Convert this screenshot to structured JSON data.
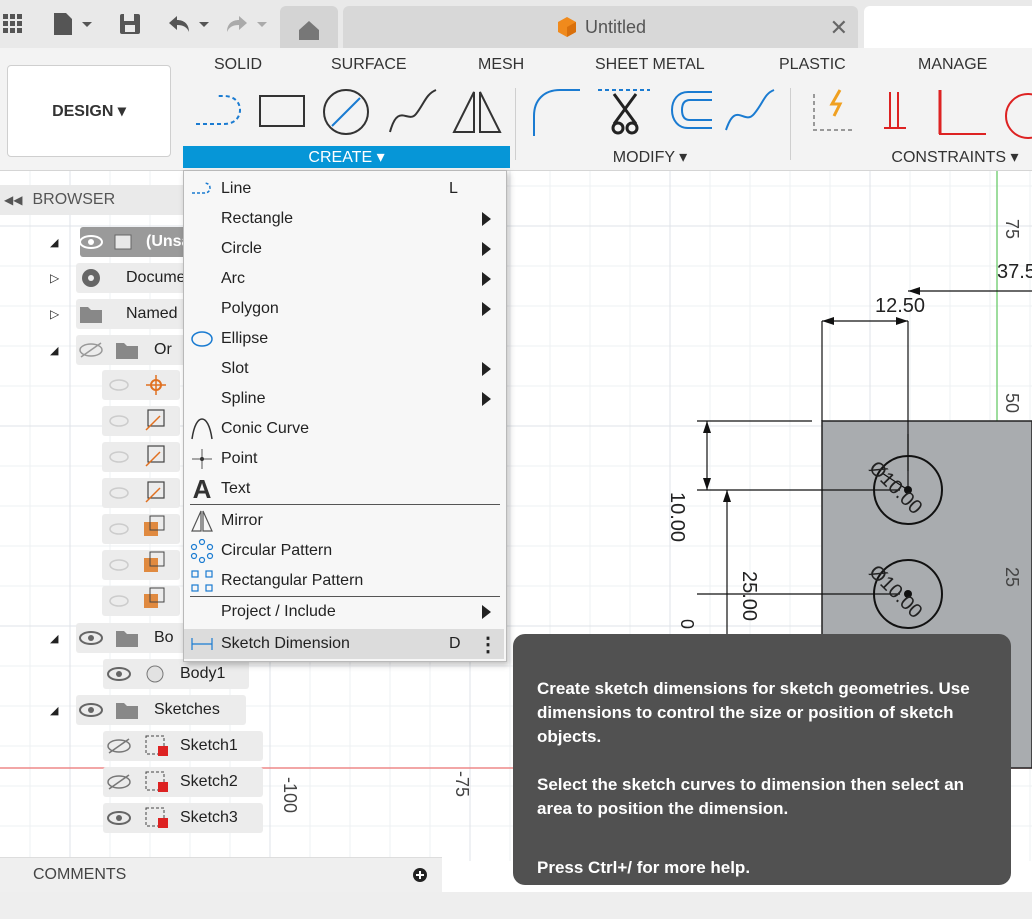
{
  "window": {
    "doc_tab_title": "Untitled"
  },
  "ribbon": {
    "workspace_button": "DESIGN ▾",
    "tabs": [
      "SOLID",
      "SURFACE",
      "MESH",
      "SHEET METAL",
      "PLASTIC",
      "MANAGE"
    ],
    "groups": {
      "create": "CREATE ▾",
      "modify": "MODIFY ▾",
      "constraints": "CONSTRAINTS ▾"
    },
    "accent_color": "#0696d7"
  },
  "browser": {
    "title": "BROWSER",
    "nodes": {
      "root": "(Unsa",
      "document_settings": "Docume",
      "named_views": "Named",
      "origin": "Or",
      "bodies": "Bo",
      "body1": "Body1",
      "sketches": "Sketches",
      "sketch1": "Sketch1",
      "sketch2": "Sketch2",
      "sketch3": "Sketch3"
    }
  },
  "comments": {
    "label": "COMMENTS"
  },
  "create_menu": {
    "items": [
      {
        "label": "Line",
        "shortcut": "L",
        "icon": "line-icon"
      },
      {
        "label": "Rectangle",
        "icon": "rectangle-icon"
      },
      {
        "label": "Circle",
        "icon": "circle-icon"
      },
      {
        "label": "Arc",
        "icon": "arc-icon"
      },
      {
        "label": "Polygon",
        "icon": "polygon-icon"
      },
      {
        "label": "Ellipse",
        "icon": "ellipse-icon"
      },
      {
        "label": "Slot",
        "icon": "slot-icon"
      },
      {
        "label": "Spline",
        "icon": "spline-icon"
      },
      {
        "label": "Conic Curve",
        "icon": "conic-curve-icon"
      },
      {
        "label": "Point",
        "icon": "point-icon"
      },
      {
        "label": "Text",
        "icon": "text-icon"
      },
      {
        "label": "Mirror",
        "icon": "mirror-icon"
      },
      {
        "label": "Circular Pattern",
        "icon": "circular-pattern-icon"
      },
      {
        "label": "Rectangular Pattern",
        "icon": "rectangular-pattern-icon"
      },
      {
        "label": "Project / Include",
        "icon": ""
      },
      {
        "label": "Sketch Dimension",
        "shortcut": "D",
        "icon": "sketch-dimension-icon"
      }
    ]
  },
  "canvas": {
    "labels": {
      "dim_top": "37.5",
      "dim_1250": "12.50",
      "dim_1000": "10.00",
      "dim_2500": "25.00",
      "dia1": "Ø10.00",
      "dia2": "Ø10.00",
      "axis_75": "75",
      "axis_50": "50",
      "axis_25": "25",
      "axis_m100": "-100",
      "axis_m75": "-75",
      "partial_zero": "0"
    }
  },
  "tooltip": {
    "p1": "Create sketch dimensions for sketch geometries. Use dimensions to control the size or position of sketch objects.",
    "p2": "Select the sketch curves to dimension then select an area to position the dimension.",
    "p3": "Press Ctrl+/ for more help."
  }
}
